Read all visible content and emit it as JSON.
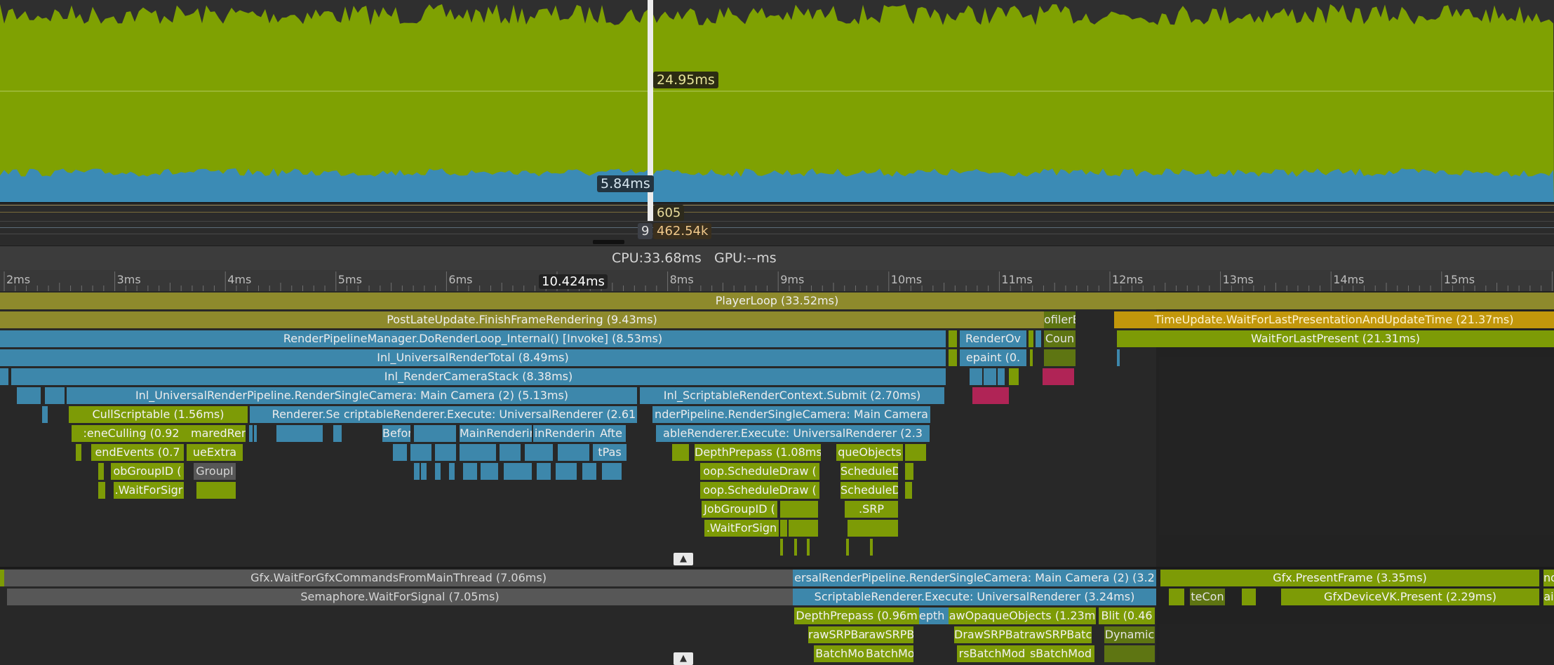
{
  "graph_labels": {
    "frame_time": "24.95ms",
    "render_time": "5.84ms",
    "counter_a": "605",
    "counter_b": "462.54k",
    "counter_c": "9"
  },
  "frame_summary": {
    "cpu": "CPU:33.68ms",
    "gpu": "GPU:--ms"
  },
  "time_ruler": {
    "ticks": [
      "2ms",
      "3ms",
      "4ms",
      "5ms",
      "6ms",
      "7ms",
      "8ms",
      "9ms",
      "10ms",
      "11ms",
      "12ms",
      "13ms",
      "14ms",
      "15ms"
    ],
    "cursor_label": "10.424ms"
  },
  "main_thread": [
    "PlayerLoop (33.52ms)",
    "PostLateUpdate.FinishFrameRendering (9.43ms)",
    "TimeUpdate.WaitForLastPresentationAndUpdateTime (21.37ms)",
    "RenderPipelineManager.DoRenderLoop_Internal() [Invoke] (8.53ms)",
    "WaitForLastPresent (21.31ms)",
    "Inl_UniversalRenderTotal (8.49ms)",
    "Inl_RenderCameraStack (8.38ms)",
    "Inl_UniversalRenderPipeline.RenderSingleCamera: Main Camera (2) (5.13ms)",
    "Inl_ScriptableRenderContext.Submit (2.70ms)",
    "CullScriptable (1.56ms)",
    "Renderer.Se",
    "criptableRenderer.Execute: UniversalRenderer (2.61",
    "nderPipeline.RenderSingleCamera: Main Camera",
    ":eneCulling (0.92",
    "maredRend",
    "MainRenderin",
    "inRenderin",
    "ableRenderer.Execute: UniversalRenderer (2.3",
    "endEvents (0.7",
    "ueExtra",
    "DepthPrepass (1.08ms",
    "queObjects",
    "obGroupID (",
    "GroupI",
    "oop.ScheduleDraw (",
    "ScheduleD",
    ".WaitForSigr",
    "oop.ScheduleDraw (",
    "ScheduleD",
    "JobGroupID (",
    ".WaitForSign",
    "RenderOv",
    "epaint (0.",
    "Befor",
    "Afte",
    "tPas",
    "ofilerE",
    "Coun",
    ".SRP"
  ],
  "render_thread": [
    "Gfx.WaitForGfxCommandsFromMainThread (7.06ms)",
    "Semaphore.WaitForSignal (7.05ms)",
    "ersalRenderPipeline.RenderSingleCamera: Main Camera (2) (3.2",
    "Gfx.PresentFrame (3.35ms)",
    "ScriptableRenderer.Execute: UniversalRenderer (3.24ms)",
    "GfxDeviceVK.Present (2.29ms)",
    "DepthPrepass (0.96m",
    "epth (",
    "awOpaqueObjects (1.23m",
    "Blit (0.46",
    "rawSRPBat",
    "rawSRPB",
    "DrawSRPBatc",
    "rawSRPBatc",
    "Dynamic",
    "BatchMo",
    "BatchMo",
    "rsBatchMod",
    "sBatchMod",
    "teCon",
    "nd",
    "ai"
  ]
}
